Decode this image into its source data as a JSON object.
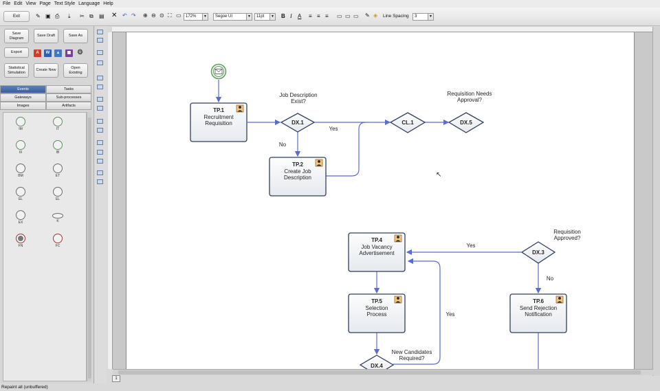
{
  "menu": [
    "File",
    "Edit",
    "View",
    "Page",
    "Text Style",
    "Language",
    "Help"
  ],
  "toolbar": {
    "exit": "Exit",
    "zoom": "172%",
    "font": "Segoe UI",
    "font_size": "11pt",
    "line_spacing_label": "Line Spacing",
    "line_spacing_value": "3"
  },
  "left_panel": {
    "buttons": [
      "Save Diagram",
      "Save Draft",
      "Save As",
      "Export",
      "Statistical Simulation",
      "Create New",
      "Open Existing"
    ],
    "tabs": [
      "Events",
      "Tasks",
      "Gateways",
      "Sub-processes",
      "Images",
      "Artifacts"
    ],
    "palette": [
      "IM",
      "IT",
      "IX",
      "IB",
      "BM",
      "ET",
      "EL",
      "EL",
      "EX",
      "K",
      "FN",
      "FC"
    ]
  },
  "diagram": {
    "tasks": [
      {
        "id": "TP.1",
        "name": "Recruitment Requisition"
      },
      {
        "id": "TP.2",
        "name": "Create Job Description"
      },
      {
        "id": "TP.4",
        "name": "Job Vacancy Advertisement"
      },
      {
        "id": "TP.5",
        "name": "Selection Process"
      },
      {
        "id": "TP.6",
        "name": "Send Rejection Notification"
      }
    ],
    "gateways": [
      "DX.1",
      "CL.1",
      "DX.5",
      "DX.3",
      "DX.4"
    ],
    "labels": {
      "q_job_desc": "Job Description Exist?",
      "q_req_approval": "Requisition Needs Approval?",
      "q_req_approved": "Requisition Approved?",
      "q_new_candidates": "New Candidates Required?",
      "yes": "Yes",
      "no": "No"
    }
  },
  "status": "Repaint all (unbuffered)",
  "page_number": "1",
  "colors": {
    "task_border": "#2f3f5c",
    "connector": "#5b6bd0",
    "tab_active": "#4a6ea8"
  }
}
